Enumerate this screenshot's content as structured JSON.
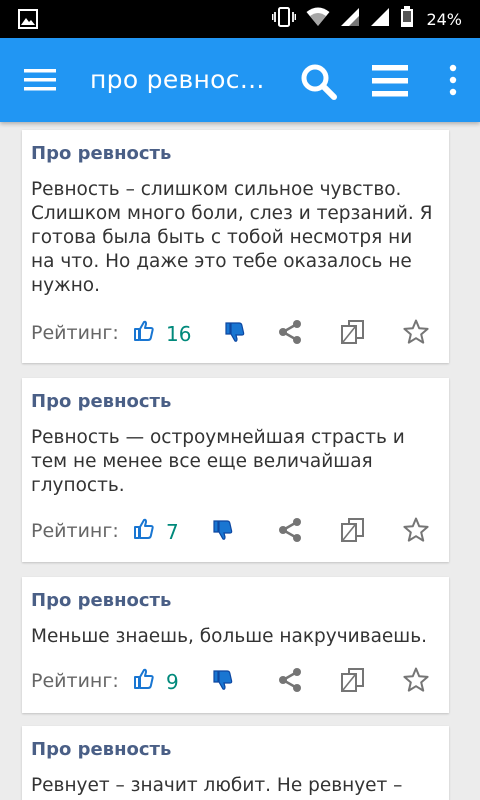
{
  "status_bar": {
    "battery_percent": "24%"
  },
  "app_bar": {
    "search_query": "про ревнос..."
  },
  "colors": {
    "app_bar": "#2196f3",
    "card_title": "#4a5f86",
    "rating_count": "#00897b",
    "icon_blue": "#1976d2",
    "icon_grey": "#757575"
  },
  "cards": [
    {
      "title": "Про ревность",
      "text": "Ревность – слишком сильное чувство. Слишком много боли, слез и терзаний. Я готова была быть с тобой несмотря ни на что. Но даже это тебе оказалось не нужно.",
      "rating_label": "Рейтинг:",
      "rating": "16"
    },
    {
      "title": "Про ревность",
      "text": "Ревность — остроумнейшая страсть и тем не менее все еще величайшая глупость.",
      "rating_label": "Рейтинг:",
      "rating": "7"
    },
    {
      "title": "Про ревность",
      "text": "Меньше знаешь, больше накручиваешь.",
      "rating_label": "Рейтинг:",
      "rating": "9"
    },
    {
      "title": "Про ревность",
      "text": "Ревнует – значит любит. Не ревнует –",
      "rating_label": "",
      "rating": ""
    }
  ]
}
